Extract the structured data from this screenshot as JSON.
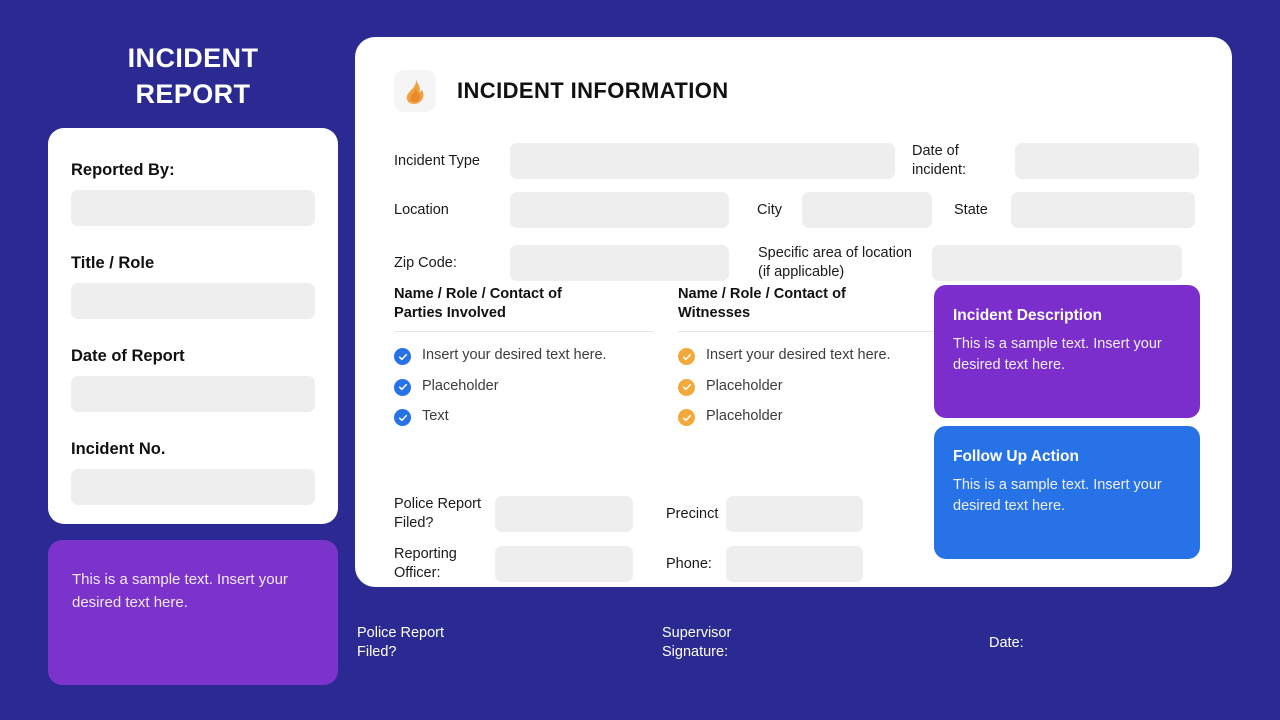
{
  "theme": {
    "background": "#2A2A92",
    "panel_bg": "#FFFFFF",
    "input_bg": "#EEEEEE",
    "accent_blue": "#2872E8",
    "accent_orange": "#F2A93B",
    "accent_purple": "#7B2ECC"
  },
  "left": {
    "title": "INCIDENT\nREPORT",
    "title_line1": "INCIDENT",
    "title_line2": "REPORT",
    "fields": [
      {
        "label": "Reported By:",
        "value": ""
      },
      {
        "label": "Title / Role",
        "value": ""
      },
      {
        "label": "Date of Report",
        "value": ""
      },
      {
        "label": "Incident No.",
        "value": ""
      }
    ],
    "note": {
      "text": "This is a sample text. Insert your desired text here."
    }
  },
  "panel": {
    "icon": "flame-icon",
    "title": "INCIDENT INFORMATION",
    "row1": {
      "label_incident_type": "Incident Type",
      "value_incident_type": "",
      "label_date_of_incident": "Date of\nincident:",
      "label_date_line1": "Date of",
      "label_date_line2": "incident:",
      "value_date_of_incident": ""
    },
    "row2": {
      "label_location": "Location",
      "value_location": "",
      "label_city": "City",
      "value_city": "",
      "label_state": "State",
      "value_state": ""
    },
    "row3": {
      "label_zip": "Zip Code:",
      "value_zip": "",
      "label_specific_area_line1": "Specific area of location",
      "label_specific_area_line2": "(if applicable)",
      "value_specific_area": ""
    },
    "parties": {
      "heading_line1": "Name / Role / Contact of",
      "heading_line2": "Parties Involved",
      "items": [
        "Insert your desired text here.",
        "Placeholder",
        "Text"
      ]
    },
    "witnesses": {
      "heading_line1": "Name / Role / Contact of",
      "heading_line2": "Witnesses",
      "items": [
        "Insert your desired text here.",
        "Placeholder",
        "Placeholder"
      ]
    },
    "row4": {
      "label_police_report_line1": "Police Report",
      "label_police_report_line2": "Filed?",
      "value_police_report": "",
      "label_precinct": "Precinct",
      "value_precinct": ""
    },
    "row5": {
      "label_reporting_officer_line1": "Reporting",
      "label_reporting_officer_line2": "Officer:",
      "value_reporting_officer": "",
      "label_phone": "Phone:",
      "value_phone": ""
    },
    "note_description": {
      "title": "Incident Description",
      "body": "This is a sample text. Insert your desired text here."
    },
    "note_followup": {
      "title": "Follow Up Action",
      "body": "This is a sample text. Insert your desired text here."
    }
  },
  "footer": {
    "police_report_line1": "Police Report",
    "police_report_line2": "Filed?",
    "supervisor_line1": "Supervisor",
    "supervisor_line2": "Signature:",
    "date_label": "Date:"
  }
}
